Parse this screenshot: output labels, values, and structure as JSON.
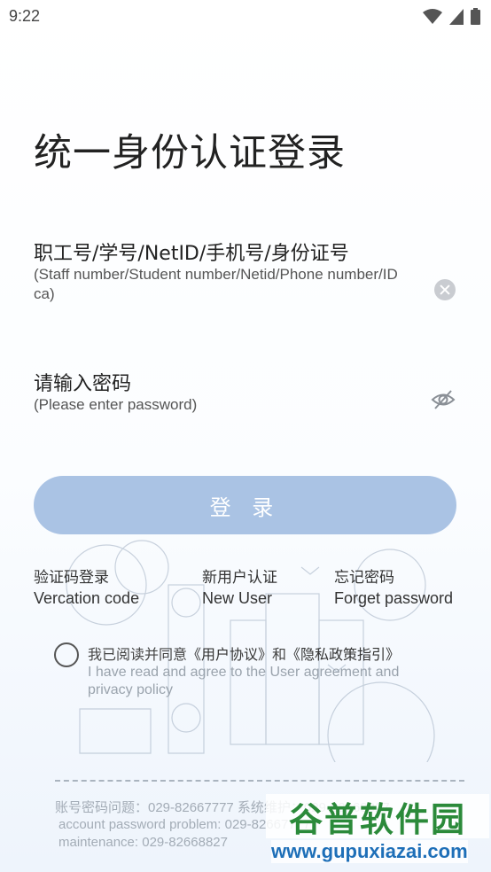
{
  "status_bar": {
    "time": "9:22",
    "icons": [
      "wifi-icon",
      "signal-icon",
      "battery-icon"
    ]
  },
  "page_title": "统一身份认证登录",
  "username": {
    "label": "职工号/学号/NetID/手机号/身份证号",
    "hint_line1": "(Staff number/Student number/Netid/Phone number/ID",
    "hint_line2": "ca)"
  },
  "password": {
    "label": "请输入密码",
    "hint": "(Please enter password)"
  },
  "login_button": "登 录",
  "links": {
    "verification": {
      "cn": "验证码登录",
      "en": "Vercation code"
    },
    "new_user": {
      "cn": "新用户认证",
      "en": "New User"
    },
    "forget": {
      "cn": "忘记密码",
      "en": "Forget password"
    }
  },
  "agreement": {
    "prefix": "我已阅读并同意",
    "user_agreement": "《用户协议》",
    "and": "和",
    "privacy": "《隐私政策指引》",
    "en": "I have read and agree to the User agreement and privacy policy"
  },
  "footer": {
    "cn": "账号密码问题：029-82667777  系统维护：029-82668827",
    "en_line1": "account password problem: 029-82667777",
    "en_line2": "maintenance: 029-82668827"
  },
  "watermark": {
    "cn": "谷普软件园",
    "url": "www.gupuxiazai.com"
  },
  "colors": {
    "button": "#aac3e4",
    "watermark_green": "#2b8a3a",
    "watermark_blue": "#1e6fb8"
  }
}
